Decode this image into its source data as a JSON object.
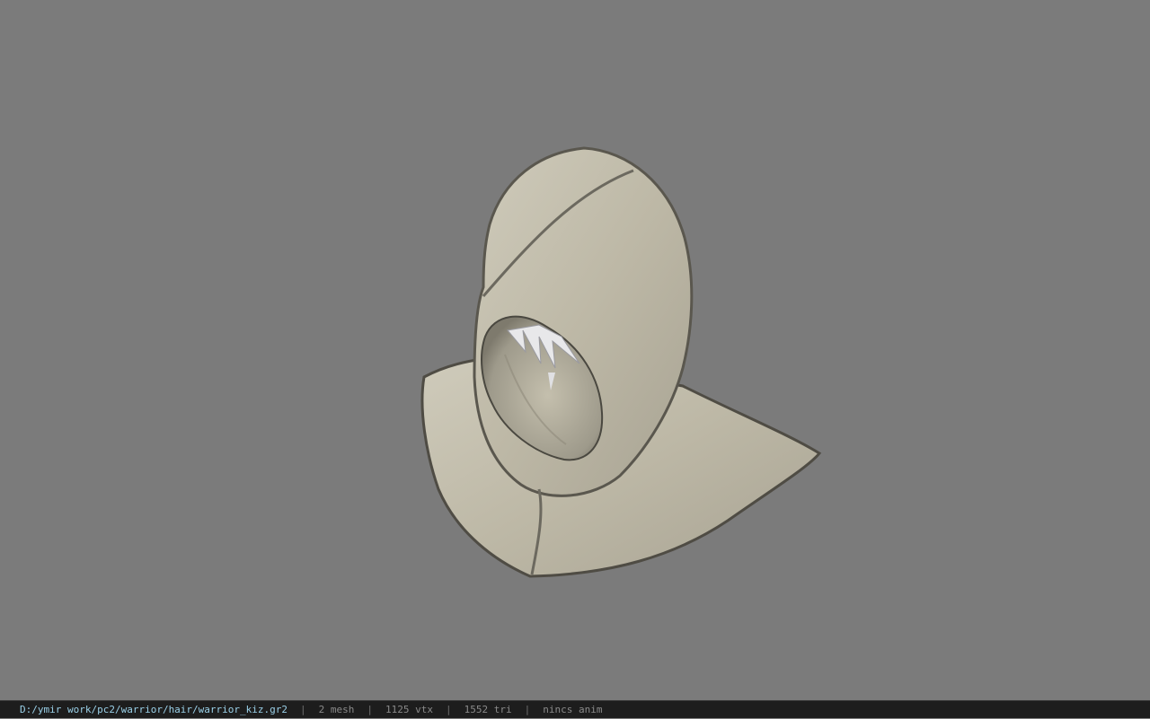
{
  "viewport": {
    "background_color": "#7b7b7b",
    "model_name": "hood-model"
  },
  "statusbar": {
    "path": "D:/ymir work/pc2/warrior/hair/warrior_kiz.gr2",
    "separator": "|",
    "mesh": "2 mesh",
    "vertices": "1125 vtx",
    "triangles": "1552 tri",
    "anim": "nincs anim",
    "path_color": "#9ad0e8",
    "text_color": "#8a8a8a"
  }
}
